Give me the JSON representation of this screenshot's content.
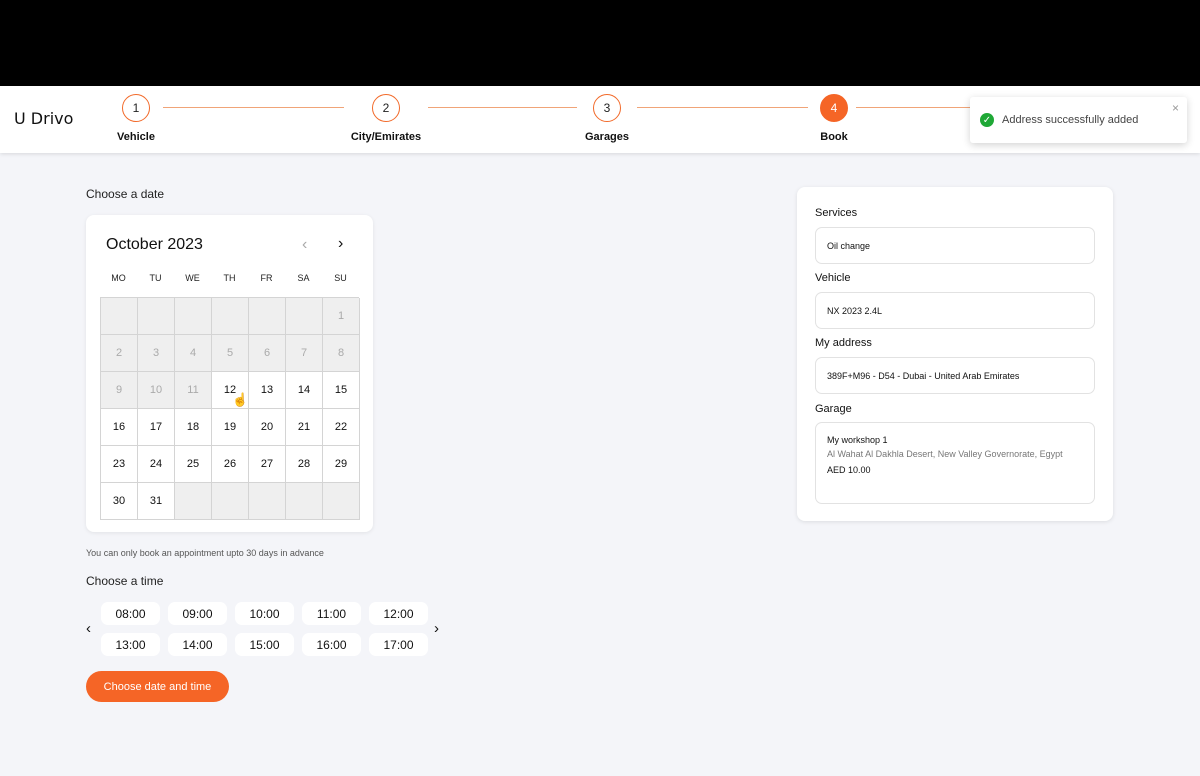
{
  "brand": "U Drivo",
  "steps": [
    {
      "number": "1",
      "label": "Vehicle"
    },
    {
      "number": "2",
      "label": "City/Emirates"
    },
    {
      "number": "3",
      "label": "Garages"
    },
    {
      "number": "4",
      "label": "Book"
    }
  ],
  "active_step": "4",
  "toast": {
    "message": "Address successfully added",
    "close": "×",
    "icon": "check-circle-icon",
    "color": "#1fa836"
  },
  "date_section": {
    "label": "Choose a date"
  },
  "calendar": {
    "month": "October 2023",
    "prev": "‹",
    "next": "›",
    "weekdays": [
      "MO",
      "TU",
      "WE",
      "TH",
      "FR",
      "SA",
      "SU"
    ],
    "days": [
      "",
      "",
      "",
      "",
      "",
      "",
      "1",
      "2",
      "3",
      "4",
      "5",
      "6",
      "7",
      "8",
      "9",
      "10",
      "11",
      "12",
      "13",
      "14",
      "15",
      "16",
      "17",
      "18",
      "19",
      "20",
      "21",
      "22",
      "23",
      "24",
      "25",
      "26",
      "27",
      "28",
      "29",
      "30",
      "31",
      "",
      "",
      "",
      "",
      ""
    ],
    "disabled_days": [
      "1",
      "2",
      "3",
      "4",
      "5",
      "6",
      "7",
      "8",
      "9",
      "10",
      "11"
    ]
  },
  "note": "You can only book an appointment upto 30 days in advance",
  "time_section": {
    "label": "Choose a time",
    "slots": [
      "08:00",
      "09:00",
      "10:00",
      "11:00",
      "12:00",
      "13:00",
      "14:00",
      "15:00",
      "16:00",
      "17:00"
    ],
    "prev": "‹",
    "next": "›"
  },
  "submit_label": "Choose date and time",
  "summary": {
    "services_label": "Services",
    "services_value": "Oil change",
    "vehicle_label": "Vehicle",
    "vehicle_value": "NX 2023 2.4L",
    "address_label": "My address",
    "address_value": "389F+M96 - D54 - Dubai - United Arab Emirates",
    "garage_label": "Garage",
    "garage_name": "My workshop 1",
    "garage_address": "Al Wahat Al Dakhla Desert, New Valley Governorate, Egypt",
    "garage_price": "AED 10.00"
  },
  "accent_color": "#f56526"
}
